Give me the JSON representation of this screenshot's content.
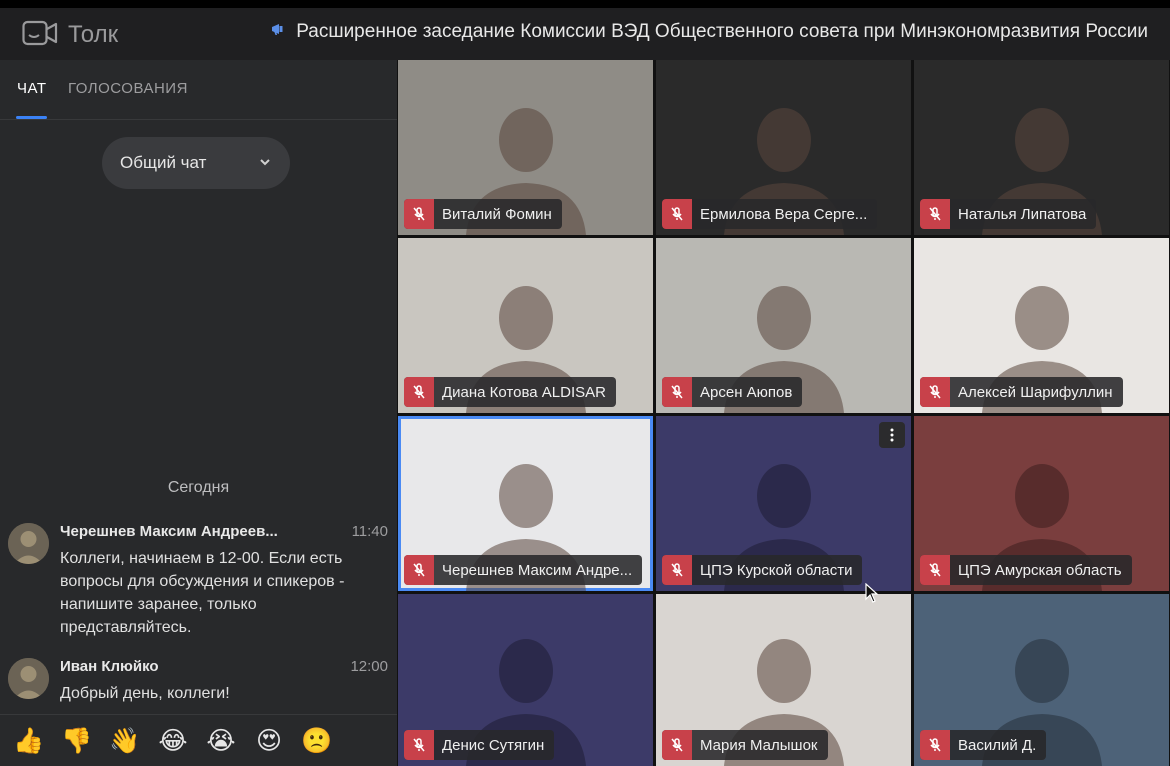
{
  "app": {
    "brand_name": "Толк",
    "meeting_title": "Расширенное заседание Комиссии ВЭД Общественного совета при Минэкономразвития России"
  },
  "sidebar": {
    "tabs": [
      {
        "label": "ЧАТ",
        "active": true
      },
      {
        "label": "ГОЛОСОВАНИЯ",
        "active": false
      }
    ],
    "chat_selector": {
      "value": "Общий чат"
    },
    "date_separator": "Сегодня",
    "messages": [
      {
        "author": "Черешнев Максим Андреев...",
        "time": "11:40",
        "text": "Коллеги, начинаем в 12-00. Если есть вопросы для обсуждения и спикеров - напишите заранее, только представляйтесь."
      },
      {
        "author": "Иван Клюйко",
        "time": "12:00",
        "text": "Добрый день, коллеги!"
      }
    ],
    "reactions": [
      "👍",
      "👎",
      "👋",
      "😂",
      "😭",
      "😍",
      "🙁"
    ]
  },
  "participants": [
    {
      "name": "Виталий Фомин",
      "bg": "#8f8c86",
      "video": true
    },
    {
      "name": "Ермилова Вера Серге...",
      "bg": "#2a2a2a",
      "video": true
    },
    {
      "name": "Наталья Липатова",
      "bg": "#2a2a2a",
      "video": true
    },
    {
      "name": "Диана Котова ALDISAR",
      "bg": "#c9c6c0",
      "video": true
    },
    {
      "name": "Арсен Аюпов",
      "bg": "#b9b8b3",
      "video": true
    },
    {
      "name": "Алексей Шарифуллин",
      "bg": "#e9e6e3",
      "video": true
    },
    {
      "name": "Черешнев Максим Андре...",
      "bg": "#e8e8ea",
      "video": true,
      "active_speaker": true
    },
    {
      "name": "ЦПЭ Курской области",
      "bg": "#3c3a68",
      "video": false
    },
    {
      "name": "ЦПЭ Амурская область",
      "bg": "#7a3e3e",
      "video": false
    },
    {
      "name": "Денис Сутягин",
      "bg": "#3c3a68",
      "video": false
    },
    {
      "name": "Мария Малышок",
      "bg": "#d9d5d1",
      "video": true
    },
    {
      "name": "Василий Д.",
      "bg": "#4d6278",
      "video": false
    }
  ],
  "colors": {
    "accent": "#3b82f6",
    "mic_off": "#c8414a",
    "sidebar_bg": "#28292b"
  }
}
